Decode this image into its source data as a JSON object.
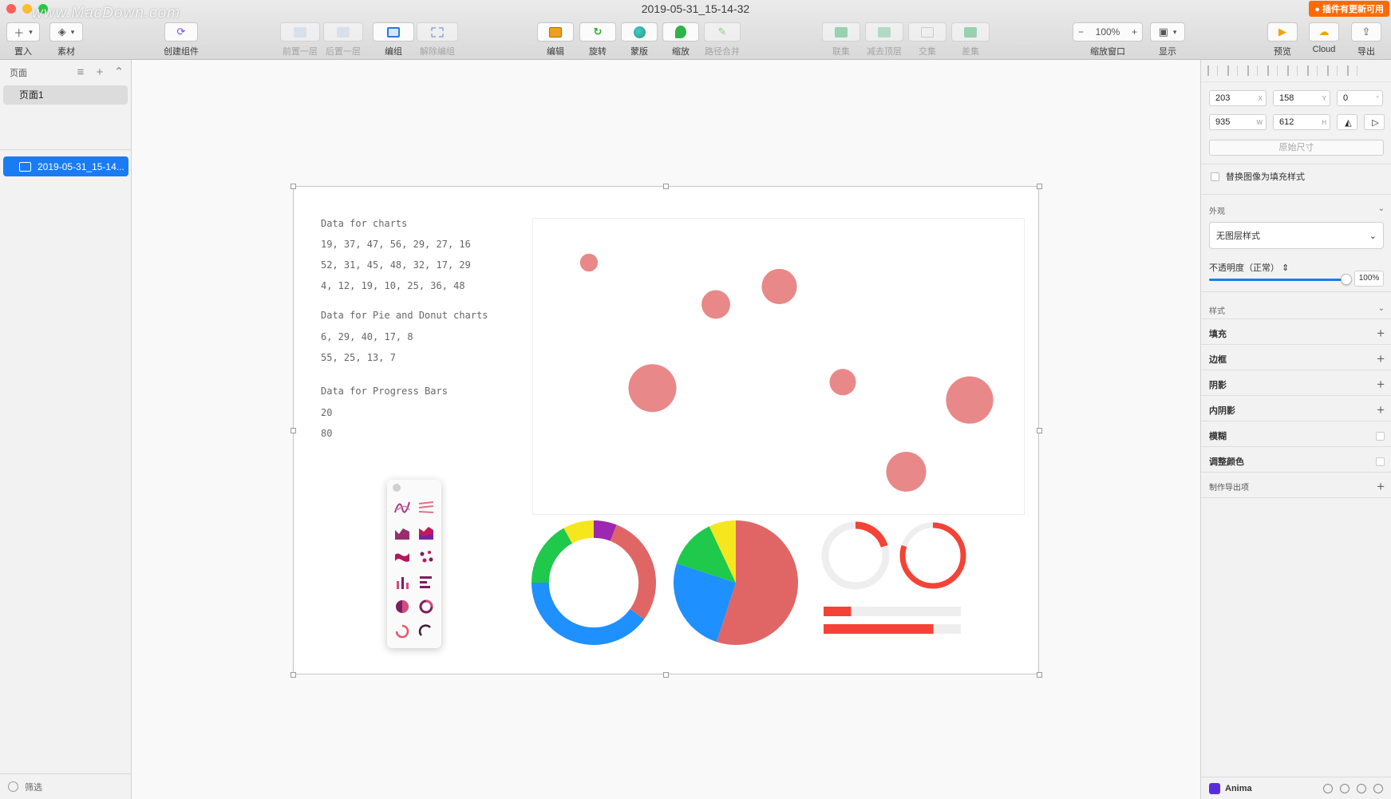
{
  "window": {
    "title": "2019-05-31_15-14-32",
    "update_badge": "● 插件有更新可用",
    "watermark": "www.MacDown.com",
    "traffic_colors": [
      "#fe5f57",
      "#febc2e",
      "#28c840"
    ]
  },
  "toolbar": {
    "insert": "置入",
    "assets": "素材",
    "create_component": "创建组件",
    "forward": "前置一层",
    "backward": "后置一层",
    "group": "编组",
    "ungroup": "解除编组",
    "edit": "编辑",
    "rotate": "旋转",
    "mask": "蒙版",
    "scale": "缩放",
    "path_merge": "路径合并",
    "union": "联集",
    "subtract": "减去顶层",
    "intersect": "交集",
    "difference": "差集",
    "zoom_label": "缩放窗口",
    "zoom_value": "100%",
    "view": "显示",
    "preview": "预览",
    "cloud": "Cloud",
    "export": "导出"
  },
  "sidebar": {
    "pages_title": "页面",
    "pages": [
      {
        "label": "页面1"
      }
    ],
    "layers": [
      {
        "label": "2019-05-31_15-14..."
      }
    ],
    "filter_label": "筛选"
  },
  "artboard": {
    "heading1": "Data for charts",
    "rows1": [
      "19, 37, 47, 56, 29, 27, 16",
      "52, 31, 45, 48, 32, 17, 29",
      "4, 12, 19, 10, 25, 36, 48"
    ],
    "heading2": "Data for Pie and Donut charts",
    "rows2": [
      "6, 29, 40, 17, 8",
      "55, 25, 13, 7"
    ],
    "heading3": "Data for Progress Bars",
    "rows3": [
      "20",
      "80"
    ]
  },
  "chart_data": [
    {
      "type": "scatter",
      "color": "#e57373",
      "points": [
        {
          "x": 1,
          "y": 52,
          "size": 4
        },
        {
          "x": 2,
          "y": 31,
          "size": 37
        },
        {
          "x": 3,
          "y": 45,
          "size": 12
        },
        {
          "x": 4,
          "y": 48,
          "size": 19
        },
        {
          "x": 5,
          "y": 32,
          "size": 10
        },
        {
          "x": 6,
          "y": 17,
          "size": 25
        },
        {
          "x": 7,
          "y": 29,
          "size": 36
        }
      ]
    },
    {
      "type": "pie",
      "variant": "donut",
      "values": [
        6,
        29,
        40,
        17,
        8
      ],
      "colors": [
        "#9c27b0",
        "#e06666",
        "#1e90ff",
        "#1ec94c",
        "#f6e61e"
      ]
    },
    {
      "type": "pie",
      "values": [
        55,
        25,
        13,
        7
      ],
      "colors": [
        "#e06666",
        "#1e90ff",
        "#1ec94c",
        "#f6e61e"
      ]
    },
    {
      "type": "progress",
      "values": [
        20,
        80
      ],
      "color": "#f44336",
      "track": "#eeeeee"
    }
  ],
  "inspector": {
    "x": "203",
    "x_unit": "X",
    "y": "158",
    "y_unit": "Y",
    "rotation": "0",
    "rotation_unit": "°",
    "w": "935",
    "w_unit": "W",
    "h": "612",
    "h_unit": "H",
    "original_size": "原始尺寸",
    "replace_fill": "替换图像为填充样式",
    "appearance": "外观",
    "layer_style": "无图层样式",
    "opacity_label": "不透明度（正常）",
    "opacity_value": "100%",
    "opacity": 1.0,
    "style_section": "样式",
    "fill": "填充",
    "border": "边框",
    "shadow": "阴影",
    "inner_shadow": "内阴影",
    "blur": "模糊",
    "adjust_color": "调整颜色",
    "export_item": "制作导出项",
    "plugin": "Anima"
  }
}
